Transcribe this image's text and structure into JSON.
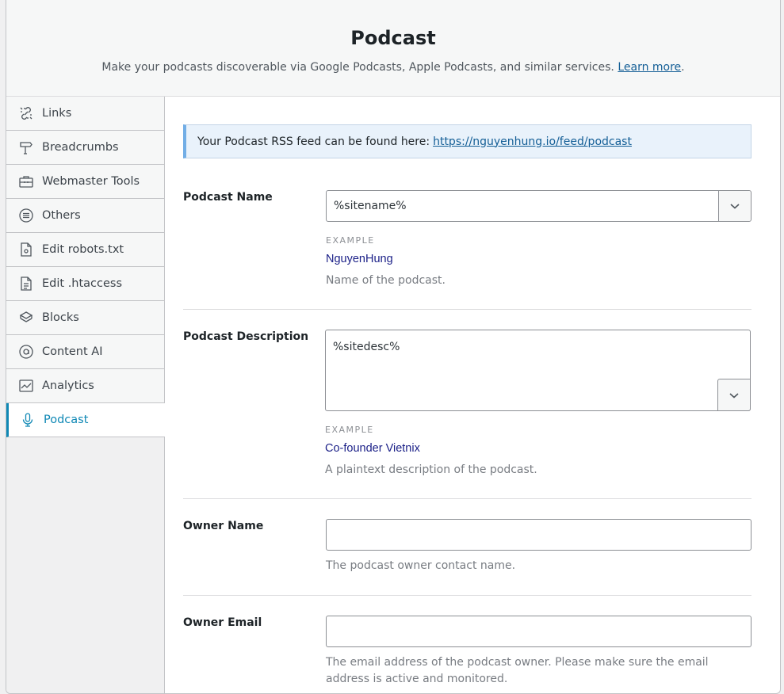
{
  "header": {
    "title": "Podcast",
    "subtitle": "Make your podcasts discoverable via Google Podcasts, Apple Podcasts, and similar services.",
    "learn_more": "Learn more",
    "period": "."
  },
  "sidebar": {
    "items": [
      {
        "label": "Links",
        "icon": "links-icon"
      },
      {
        "label": "Breadcrumbs",
        "icon": "signpost-icon"
      },
      {
        "label": "Webmaster Tools",
        "icon": "toolbox-icon"
      },
      {
        "label": "Others",
        "icon": "list-circle-icon"
      },
      {
        "label": "Edit robots.txt",
        "icon": "robots-file-icon"
      },
      {
        "label": "Edit .htaccess",
        "icon": "document-icon"
      },
      {
        "label": "Blocks",
        "icon": "blocks-icon"
      },
      {
        "label": "Content AI",
        "icon": "content-ai-icon"
      },
      {
        "label": "Analytics",
        "icon": "analytics-icon"
      },
      {
        "label": "Podcast",
        "icon": "microphone-icon",
        "active": true
      }
    ]
  },
  "notice": {
    "text": "Your Podcast RSS feed can be found here:",
    "link": "https://nguyenhung.io/feed/podcast"
  },
  "fields": {
    "podcast_name": {
      "label": "Podcast Name",
      "value": "%sitename%",
      "example_label": "EXAMPLE",
      "example_value": "NguyenHung",
      "description": "Name of the podcast."
    },
    "podcast_description": {
      "label": "Podcast Description",
      "value": "%sitedesc%",
      "example_label": "EXAMPLE",
      "example_value": "Co-founder Vietnix",
      "description": "A plaintext description of the podcast."
    },
    "owner_name": {
      "label": "Owner Name",
      "value": "",
      "description": "The podcast owner contact name."
    },
    "owner_email": {
      "label": "Owner Email",
      "value": "",
      "description": "The email address of the podcast owner. Please make sure the email address is active and monitored."
    }
  },
  "colors": {
    "accent": "#0f88b5",
    "link": "#135e96",
    "example": "#1a1f87"
  }
}
